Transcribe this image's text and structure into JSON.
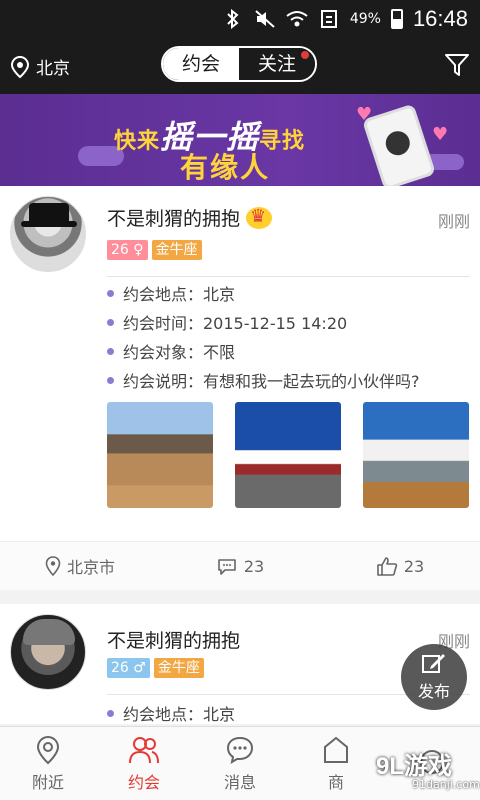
{
  "status_bar": {
    "battery": "49%",
    "time": "16:48"
  },
  "header": {
    "location": "北京",
    "tabs": [
      {
        "label": "约会",
        "active": true
      },
      {
        "label": "关注",
        "active": false
      }
    ]
  },
  "banner": {
    "line1_a": "快来",
    "line1_big": "摇一摇",
    "line1_b": "寻找",
    "line2": "有缘人"
  },
  "posts": [
    {
      "name": "不是刺猬的拥抱",
      "time": "刚刚",
      "age_tag": "26 ♀",
      "zodiac": "金牛座",
      "details": [
        "约会地点：北京",
        "约会时间：2015-12-15 14:20",
        "约会对象：不限",
        "约会说明：有想和我一起去玩的小伙伴吗?"
      ],
      "actions": {
        "location": "北京市",
        "comments": "23",
        "likes": "23"
      }
    },
    {
      "name": "不是刺猬的拥抱",
      "time": "刚刚",
      "age_tag": "26 ♂",
      "zodiac": "金牛座",
      "details": [
        "约会地点：北京"
      ]
    }
  ],
  "fab_label": "发布",
  "tabbar": [
    {
      "label": "附近",
      "icon": "location-pin-icon",
      "active": false
    },
    {
      "label": "约会",
      "icon": "people-icon",
      "active": true
    },
    {
      "label": "消息",
      "icon": "chat-icon",
      "active": false
    },
    {
      "label": "商",
      "icon": "shop-icon",
      "active": false
    },
    {
      "label": "",
      "icon": "profile-icon",
      "active": false
    }
  ],
  "watermark": {
    "main": "9L游戏",
    "sub": "91danji.com"
  },
  "colors": {
    "accent": "#e53935",
    "banner": "#6a37a5",
    "bullet": "#8e7ad2"
  }
}
